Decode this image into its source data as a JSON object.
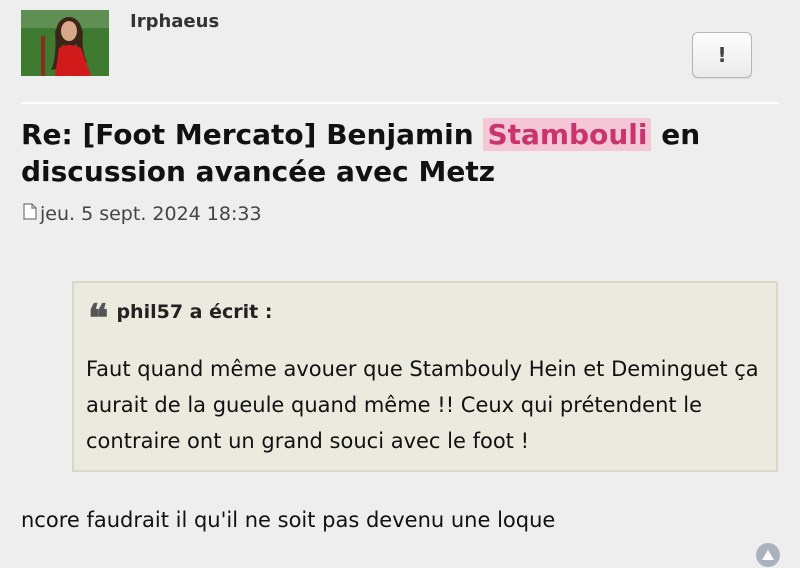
{
  "author": {
    "username": "Irphaeus"
  },
  "actions": {
    "report_label": "!"
  },
  "post": {
    "title_prefix": "Re: [Foot Mercato] Benjamin ",
    "title_highlight": "Stambouli",
    "title_suffix": " en discussion avancée avec Metz",
    "date": "jeu. 5 sept. 2024 18:33",
    "highlight_colors": {
      "background": "#f5c6d6",
      "text": "#c8346b"
    }
  },
  "quote": {
    "author_line": "phil57 a écrit :",
    "text": "Faut quand même avouer que Stambouly Hein et Deminguet ça aurait de la gueule quand même !! Ceux qui prétendent le contraire ont un grand souci avec le foot !"
  },
  "reply": {
    "text": "ncore faudrait il qu'il ne soit pas devenu une loque"
  },
  "icons": {
    "post_icon": "document-icon",
    "quote_icon": "quote-icon",
    "top_icon": "back-to-top-icon"
  }
}
